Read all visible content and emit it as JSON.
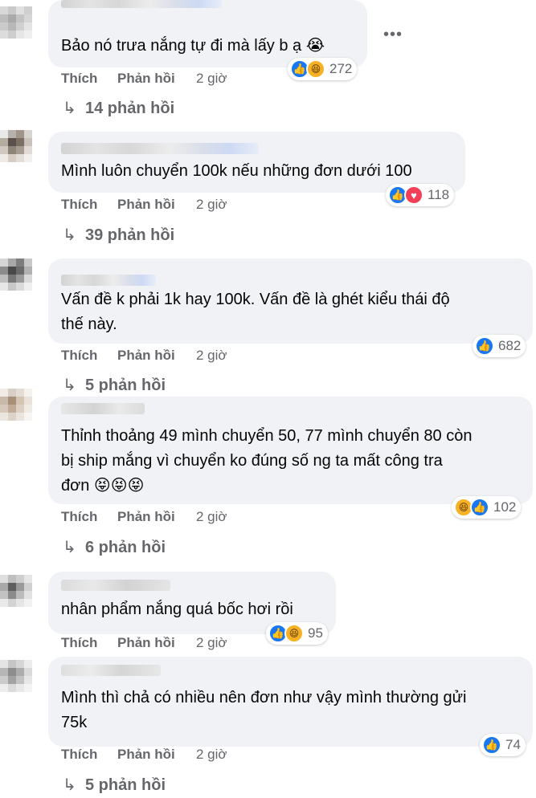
{
  "comments": [
    {
      "text": "Bảo nó trưa nắng tự đi mà lấy b ạ 😭",
      "like": "Thích",
      "reply": "Phản hồi",
      "time": "2 giờ",
      "reactions": [
        "like-icon",
        "haha-icon"
      ],
      "count": "272",
      "replies": "14 phản hồi"
    },
    {
      "text": "Mình luôn chuyển 100k nếu những đơn dưới 100",
      "like": "Thích",
      "reply": "Phản hồi",
      "time": "2 giờ",
      "reactions": [
        "like-icon",
        "love-icon"
      ],
      "count": "118",
      "replies": "39 phản hồi"
    },
    {
      "text": "Vấn đề k phải 1k hay 100k. Vấn đề là ghét kiểu thái độ thế này.",
      "line1": "Vấn đề k phải 1k hay 100k. Vấn đề là ghét kiểu thái độ",
      "line2": "thế này.",
      "like": "Thích",
      "reply": "Phản hồi",
      "time": "2 giờ",
      "reactions": [
        "like-icon"
      ],
      "count": "682",
      "replies": "5 phản hồi"
    },
    {
      "line1": "Thỉnh thoảng 49 mình chuyển 50, 77 mình chuyển 80 còn",
      "line2": "bị ship mắng vì chuyển ko đúng số ng ta mất công tra",
      "line3": "đơn 😝😝😝",
      "like": "Thích",
      "reply": "Phản hồi",
      "time": "2 giờ",
      "reactions": [
        "haha-icon",
        "like-icon"
      ],
      "count": "102",
      "replies": "6 phản hồi"
    },
    {
      "text": "nhân phẩm nắng quá bốc hơi rồi",
      "like": "Thích",
      "reply": "Phản hồi",
      "time": "2 giờ",
      "reactions": [
        "like-icon",
        "haha-icon"
      ],
      "count": "95"
    },
    {
      "line1": "Mình thì chả có nhiều nên đơn như vậy mình thường gửi",
      "line2": "75k",
      "like": "Thích",
      "reply": "Phản hồi",
      "time": "2 giờ",
      "reactions": [
        "like-icon"
      ],
      "count": "74",
      "replies": "5 phản hồi"
    }
  ],
  "more_options": "•••",
  "reply_arrow": "↳"
}
